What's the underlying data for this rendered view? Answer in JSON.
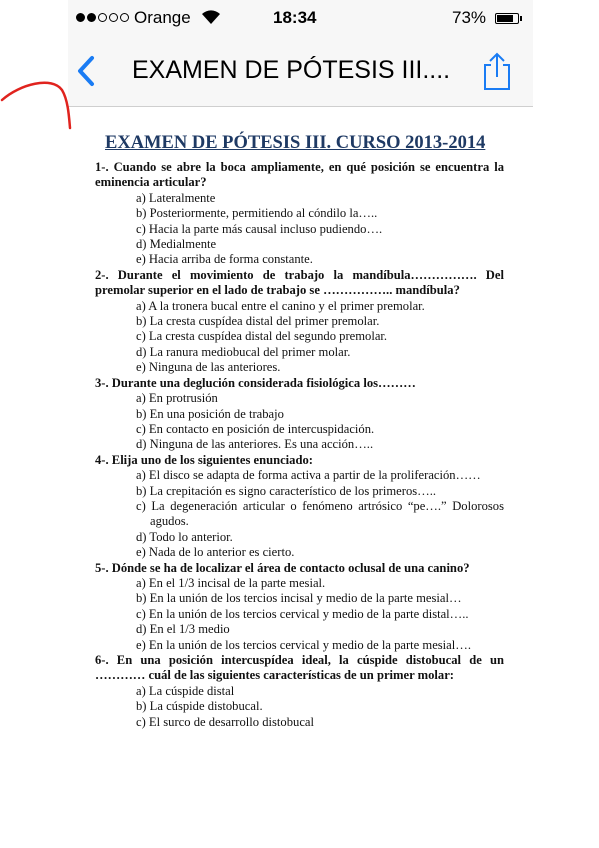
{
  "status_bar": {
    "carrier": "Orange",
    "time": "18:34",
    "battery": "73%"
  },
  "nav": {
    "title": "EXAMEN DE PÓTESIS III...."
  },
  "document": {
    "title": "EXAMEN DE PÓTESIS III. CURSO 2013-2014",
    "questions": [
      {
        "text": "1-. Cuando se abre la boca ampliamente, en qué posición se encuentra la eminencia articular?",
        "options": [
          "a) Lateralmente",
          "b) Posteriormente, permitiendo al cóndilo la…..",
          "c) Hacia la parte más causal incluso pudiendo….",
          "d) Medialmente",
          "e) Hacia arriba de forma constante."
        ]
      },
      {
        "text": "2-. Durante el movimiento de trabajo la mandíbula……………. Del premolar superior en el lado de trabajo se …………….. mandíbula?",
        "options": [
          "a) A la tronera bucal entre el canino y el primer premolar.",
          "b) La cresta cuspídea distal del primer premolar.",
          "c) La cresta cuspídea distal del segundo premolar.",
          "d) La ranura mediobucal del primer molar.",
          "e) Ninguna de las anteriores."
        ]
      },
      {
        "text": "3-. Durante una deglución considerada fisiológica los………",
        "options": [
          "a) En protrusión",
          "b) En una posición de trabajo",
          "c) En contacto en posición de intercuspidación.",
          "d) Ninguna de las anteriores. Es una acción….."
        ]
      },
      {
        "text": "4-. Elija uno de los siguientes enunciado:",
        "options": [
          "a) El disco se adapta de forma activa a partir de la proliferación……",
          "b) La crepitación es signo característico de los primeros…..",
          "c) La degeneración articular o fenómeno artrósico “pe….” Dolorosos agudos.",
          "d) Todo lo anterior.",
          "e) Nada de lo anterior es cierto."
        ]
      },
      {
        "text": "5-. Dónde se ha de localizar el área de contacto oclusal de una canino?",
        "options": [
          "a) En el 1/3 incisal de la parte mesial.",
          "b) En la unión de los tercios incisal y medio de la parte mesial…",
          "c) En la unión de los tercios cervical y medio de la parte distal…..",
          "d) En el 1/3 medio",
          "e) En la unión de los tercios cervical y medio de la parte mesial…."
        ]
      },
      {
        "text": "6-. En una posición intercuspídea ideal, la cúspide distobucal de un ………… cuál de las siguientes características de un primer molar:",
        "options": [
          "a) La cúspide distal",
          "b) La cúspide distobucal.",
          "c) El surco de desarrollo distobucal"
        ]
      }
    ]
  },
  "colors": {
    "doc_title": "#1f3a64",
    "ios_blue": "#1a7cf4",
    "pen_mark": "#e0231e"
  },
  "icons": [
    "back-chevron-icon",
    "share-icon",
    "wifi-icon",
    "battery-icon"
  ]
}
